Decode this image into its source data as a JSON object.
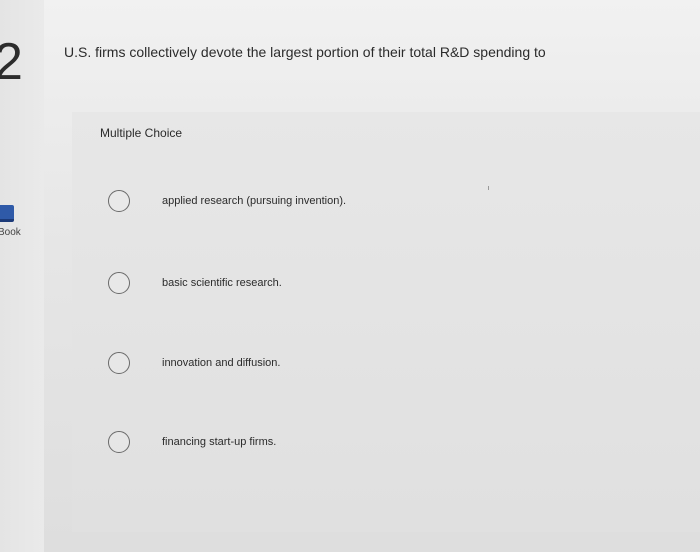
{
  "question": {
    "number": "2",
    "text": "U.S. firms collectively devote the largest portion of their total R&D spending to"
  },
  "sidebar": {
    "ebook_label": "Book",
    "ebook_icon": "book-icon"
  },
  "answer_area": {
    "type_label": "Multiple Choice",
    "choices": [
      {
        "label": "applied research (pursuing invention)."
      },
      {
        "label": "basic scientific research."
      },
      {
        "label": "innovation and diffusion."
      },
      {
        "label": "financing start-up firms."
      }
    ]
  },
  "colors": {
    "ebook_icon": "#2f5aa8"
  }
}
